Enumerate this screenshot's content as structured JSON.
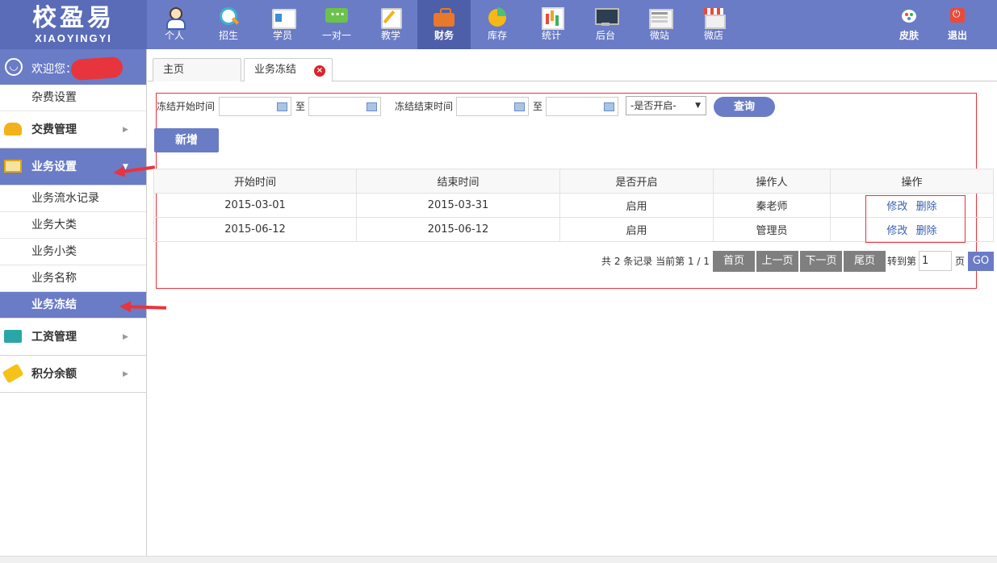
{
  "logo": {
    "zh": "校盈易",
    "en": "XIAOYINGYI"
  },
  "nav": [
    {
      "label": "个人",
      "icon": "person-icon"
    },
    {
      "label": "招生",
      "icon": "search-icon"
    },
    {
      "label": "学员",
      "icon": "card-icon"
    },
    {
      "label": "一对一",
      "icon": "chat-icon"
    },
    {
      "label": "教学",
      "icon": "note-icon"
    },
    {
      "label": "财务",
      "icon": "briefcase-icon",
      "active": true
    },
    {
      "label": "库存",
      "icon": "pie-chart-icon"
    },
    {
      "label": "统计",
      "icon": "bar-chart-icon"
    },
    {
      "label": "后台",
      "icon": "monitor-icon"
    },
    {
      "label": "微站",
      "icon": "web-page-icon"
    },
    {
      "label": "微店",
      "icon": "shop-icon"
    }
  ],
  "nav_right": [
    {
      "label": "皮肤",
      "icon": "palette-icon"
    },
    {
      "label": "退出",
      "icon": "power-icon"
    }
  ],
  "sidebar": {
    "welcome": "欢迎您：",
    "misc_fee": "杂费设置",
    "groups": {
      "payment": "交费管理",
      "business": "业务设置",
      "salary": "工资管理",
      "points": "积分余额"
    },
    "business_items": [
      "业务流水记录",
      "业务大类",
      "业务小类",
      "业务名称",
      "业务冻结"
    ]
  },
  "tabs": [
    {
      "label": "主页"
    },
    {
      "label": "业务冻结",
      "closable": true
    }
  ],
  "filter": {
    "freeze_start_label": "冻结开始时间",
    "freeze_end_label": "冻结结束时间",
    "to": "至",
    "enabled_select": "-是否开启-",
    "query_button": "查询",
    "add_button": "新增"
  },
  "table": {
    "headers": [
      "开始时间",
      "结束时间",
      "是否开启",
      "操作人",
      "操作"
    ],
    "rows": [
      {
        "start": "2015-03-01",
        "end": "2015-03-31",
        "enabled": "启用",
        "operator": "秦老师"
      },
      {
        "start": "2015-06-12",
        "end": "2015-06-12",
        "enabled": "启用",
        "operator": "管理员"
      }
    ],
    "edit": "修改",
    "delete": "删除"
  },
  "pager": {
    "info": "共 2 条记录 当前第 1 / 1",
    "first": "首页",
    "prev": "上一页",
    "next": "下一页",
    "last": "尾页",
    "jump_label": "转到第",
    "page_value": "1",
    "page_unit": "页",
    "go": "GO"
  },
  "colors": {
    "primary": "#6a7cc6",
    "annotation": "#e8343c"
  }
}
